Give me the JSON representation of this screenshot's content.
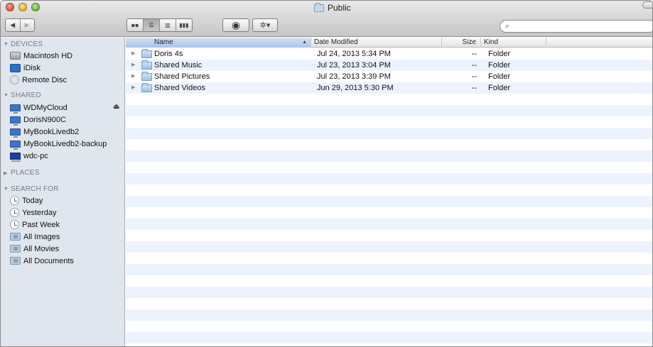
{
  "window": {
    "title": "Public"
  },
  "toolbar": {
    "back_glyph": "◀",
    "forward_glyph": "▶",
    "view_icons": [
      "icon-view-icon",
      "list-view-icon",
      "column-view-icon",
      "coverflow-view-icon"
    ],
    "view_glyphs": [
      "▪▪",
      "☰",
      "▥",
      "▮▮▮"
    ],
    "quicklook_glyph": "◉",
    "action_glyph": "✲▾",
    "search": {
      "value": "",
      "placeholder": "",
      "icon": "search-icon",
      "glyph": "🔍"
    }
  },
  "sidebar": {
    "devices": {
      "heading": "DEVICES",
      "items": [
        {
          "label": "Macintosh HD",
          "icon": "hard-drive-icon"
        },
        {
          "label": "iDisk",
          "icon": "idisk-icon"
        },
        {
          "label": "Remote Disc",
          "icon": "disc-icon"
        }
      ]
    },
    "shared": {
      "heading": "SHARED",
      "items": [
        {
          "label": "WDMyCloud",
          "icon": "network-computer-icon"
        },
        {
          "label": "DorisN900C",
          "icon": "network-computer-icon"
        },
        {
          "label": "MyBookLivedb2",
          "icon": "network-computer-icon"
        },
        {
          "label": "MyBookLivedb2-backup",
          "icon": "network-computer-icon"
        },
        {
          "label": "wdc-pc",
          "icon": "pc-icon"
        }
      ],
      "eject_glyph": "⏏"
    },
    "places": {
      "heading": "PLACES"
    },
    "search_for": {
      "heading": "SEARCH FOR",
      "items": [
        {
          "label": "Today",
          "icon": "clock-icon"
        },
        {
          "label": "Yesterday",
          "icon": "clock-icon"
        },
        {
          "label": "Past Week",
          "icon": "clock-icon"
        },
        {
          "label": "All Images",
          "icon": "smart-folder-icon"
        },
        {
          "label": "All Movies",
          "icon": "smart-folder-icon"
        },
        {
          "label": "All Documents",
          "icon": "smart-folder-icon"
        }
      ]
    }
  },
  "list": {
    "columns": {
      "name": "Name",
      "date": "Date Modified",
      "size": "Size",
      "kind": "Kind"
    },
    "sort_glyph": "▲",
    "rows": [
      {
        "name": "Doris 4s",
        "date": "Jul 24, 2013 5:34 PM",
        "size": "--",
        "kind": "Folder"
      },
      {
        "name": "Shared Music",
        "date": "Jul 23, 2013 3:04 PM",
        "size": "--",
        "kind": "Folder"
      },
      {
        "name": "Shared Pictures",
        "date": "Jul 23, 2013 3:39 PM",
        "size": "--",
        "kind": "Folder"
      },
      {
        "name": "Shared Videos",
        "date": "Jun 29, 2013 5:30 PM",
        "size": "--",
        "kind": "Folder"
      }
    ]
  }
}
